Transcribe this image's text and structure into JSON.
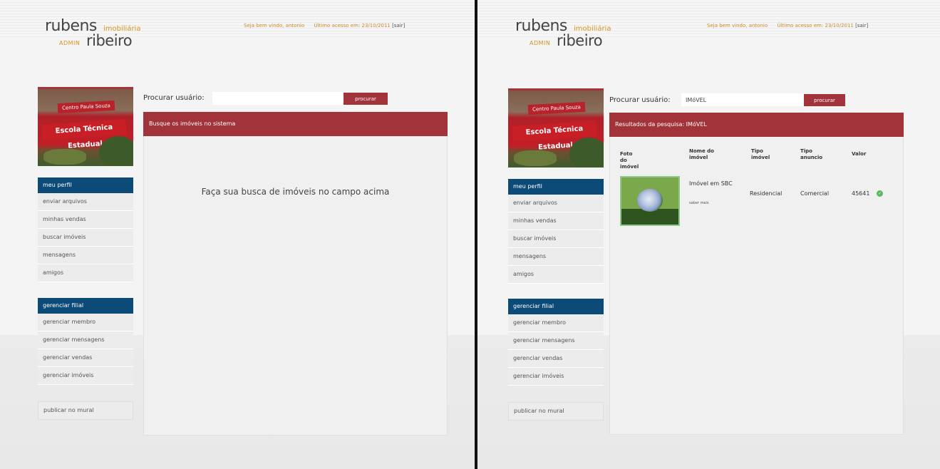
{
  "brand": {
    "name_top": "rubens",
    "imobiliaria": "imobiliária",
    "admin": "ADMIN",
    "name_bottom": "ribeiro"
  },
  "header": {
    "welcome": "Seja bem vindo, antonio",
    "last_access": "Último acesso em: 23/10/2011",
    "logout": "[sair]"
  },
  "sidebar": {
    "image_sign_small": "Centro Paula Souza",
    "image_sign_large": "Escola Técnica Estadual",
    "menu1": {
      "head": "meu perfil",
      "items": [
        "enviar arquivos",
        "minhas vendas",
        "buscar imóveis",
        "mensagens",
        "amigos"
      ]
    },
    "menu2": {
      "head": "gerenciar filial",
      "items": [
        "gerenciar membro",
        "gerenciar mensagens",
        "gerenciar vendas",
        "gerenciar imóveis"
      ]
    },
    "mural": "publicar no mural"
  },
  "left": {
    "search_label": "Procurar usuário:",
    "search_value": "",
    "search_button": "procurar",
    "bar_title": "Busque os imóveis no sistema",
    "message": "Faça sua busca de imóveis no campo acima"
  },
  "right": {
    "search_label": "Procurar usuário:",
    "search_value": "IMóVEL",
    "search_button": "procurar",
    "bar_title": "Resultados da pesquisa: IMóVEL",
    "columns": [
      "Foto do imóvel",
      "Nome do imóvel",
      "Tipo imóvel",
      "Tipo anuncio",
      "Valor"
    ],
    "row": {
      "name": "Imóvel em SBC",
      "more": "saber mais",
      "tipo_imovel": "Residencial",
      "tipo_anuncio": "Comercial",
      "valor": "45641"
    }
  },
  "icons": {
    "status": "check-circle-icon"
  },
  "colors": {
    "accent_red": "#a3333a",
    "nav_blue": "#0c4a78",
    "brand_orange": "#d4941e",
    "ok_green": "#5cb85c"
  }
}
